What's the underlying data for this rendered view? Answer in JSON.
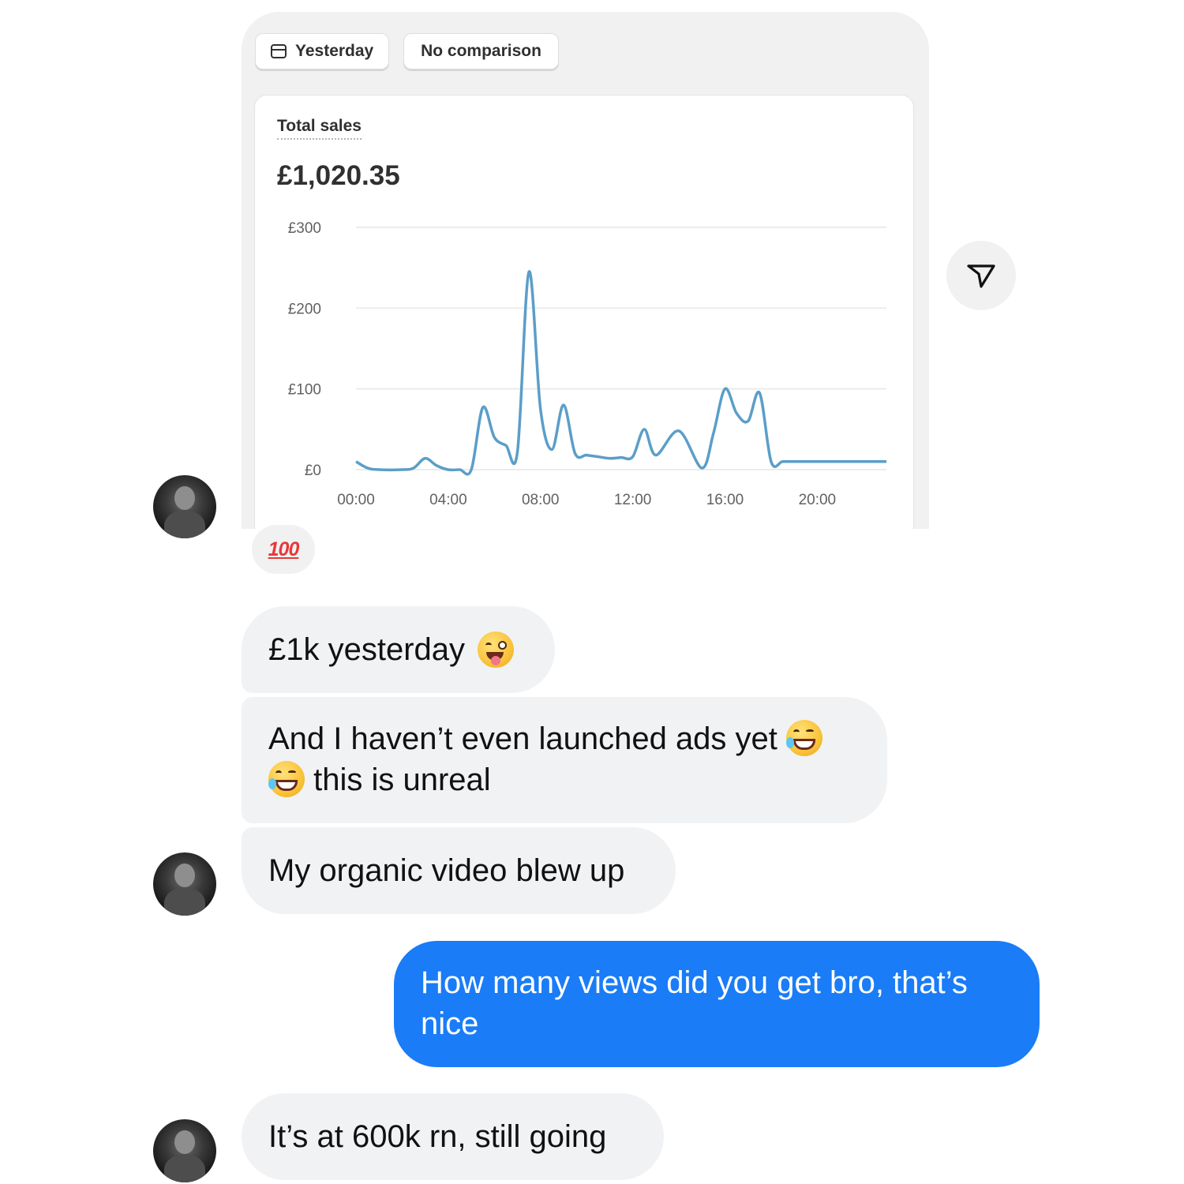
{
  "conversation": {
    "shared_image": {
      "date_filter_label": "Yesterday",
      "comparison_label": "No comparison",
      "metric_title": "Total sales",
      "metric_value": "£1,020.35"
    },
    "reaction": "100",
    "messages": [
      {
        "from": "them",
        "text": "£1k yesterday",
        "emoji": "winking-tongue-face"
      },
      {
        "from": "them",
        "line1": "And I haven’t even launched ads yet",
        "line2": "this is unreal",
        "emoji": "rolling-on-floor-laughing"
      },
      {
        "from": "them",
        "text": "My organic video blew up"
      },
      {
        "from": "me",
        "line1": "How many views did you get bro, that’s",
        "line2": "nice"
      },
      {
        "from": "them",
        "text": "It’s at 600k rn, still going"
      }
    ],
    "colors": {
      "incoming_bubble": "#f1f2f4",
      "outgoing_bubble": "#1a7cf7",
      "chart_line": "#5b9ec8"
    }
  },
  "chart_data": {
    "type": "line",
    "title": "Total sales",
    "xlabel": "",
    "ylabel": "",
    "x_ticks": [
      "00:00",
      "04:00",
      "08:00",
      "12:00",
      "16:00",
      "20:00"
    ],
    "y_ticks": [
      "£300",
      "£200",
      "£100",
      "£0"
    ],
    "ylim": [
      0,
      300
    ],
    "xlim_hours": [
      0,
      23
    ],
    "grid": true,
    "series": [
      {
        "x": [
          0,
          0.5,
          1,
          2,
          2.5,
          3,
          3.5,
          4,
          4.5,
          5,
          5.5,
          6,
          6.5,
          7,
          7.5,
          8,
          8.5,
          9,
          9.5,
          10,
          10.5,
          11,
          11.5,
          12,
          12.5,
          13,
          14,
          15,
          15.5,
          16,
          16.5,
          17,
          17.5,
          18,
          18.5,
          19,
          19.5,
          20,
          20.5,
          21,
          21.5,
          22,
          22.5,
          23
        ],
        "y": [
          10,
          2,
          0,
          0,
          2,
          14,
          5,
          0,
          0,
          0,
          77,
          40,
          30,
          22,
          245,
          75,
          25,
          80,
          20,
          18,
          16,
          14,
          15,
          16,
          50,
          18,
          48,
          2,
          45,
          100,
          70,
          60,
          95,
          10,
          10,
          10,
          10,
          10,
          10,
          10,
          10,
          10,
          10,
          10
        ]
      }
    ]
  }
}
